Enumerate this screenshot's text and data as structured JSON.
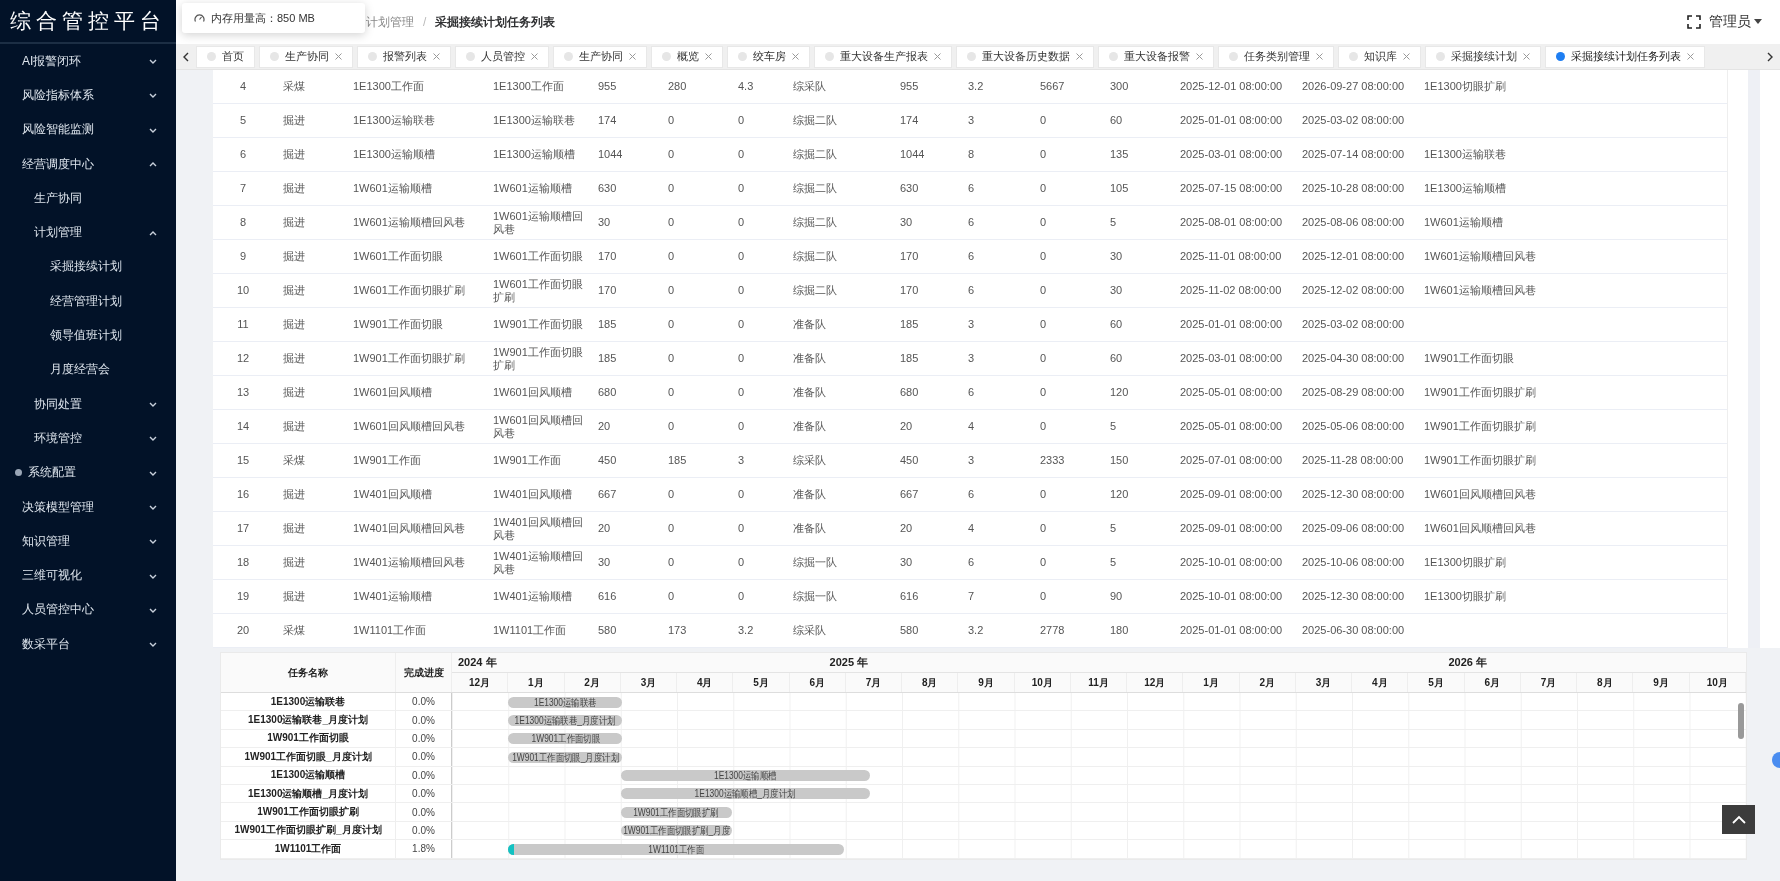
{
  "sidebar": {
    "title": "综合管控平台",
    "items": [
      {
        "kind": "group",
        "label": "AI报警闭环",
        "expanded": false
      },
      {
        "kind": "group",
        "label": "风险指标体系",
        "expanded": false
      },
      {
        "kind": "group",
        "label": "风险智能监测",
        "expanded": false
      },
      {
        "kind": "group",
        "label": "经营调度中心",
        "expanded": true,
        "children": [
          {
            "kind": "link",
            "label": "生产协同"
          },
          {
            "kind": "group",
            "label": "计划管理",
            "expanded": true,
            "children": [
              {
                "kind": "link",
                "label": "采掘接续计划"
              },
              {
                "kind": "link",
                "label": "经营管理计划"
              },
              {
                "kind": "link",
                "label": "领导值班计划"
              },
              {
                "kind": "link",
                "label": "月度经营会"
              }
            ]
          },
          {
            "kind": "group",
            "label": "协同处置",
            "expanded": false
          },
          {
            "kind": "group",
            "label": "环境管控",
            "expanded": false
          }
        ]
      },
      {
        "kind": "dotted-group",
        "label": "系统配置",
        "expanded": false
      },
      {
        "kind": "group",
        "label": "决策模型管理",
        "expanded": false
      },
      {
        "kind": "group",
        "label": "知识管理",
        "expanded": false
      },
      {
        "kind": "group",
        "label": "三维可视化",
        "expanded": false
      },
      {
        "kind": "group",
        "label": "人员管控中心",
        "expanded": false
      },
      {
        "kind": "group",
        "label": "数采平台",
        "expanded": false
      }
    ]
  },
  "memory_tooltip": {
    "text": "内存用量高：850 MB"
  },
  "breadcrumb": {
    "separator": "/",
    "items": [
      "计划管理",
      "采掘接续计划任务列表"
    ]
  },
  "user": {
    "name": "管理员"
  },
  "tabs": [
    {
      "label": "首页",
      "selected": false,
      "closable": false
    },
    {
      "label": "生产协同",
      "selected": false,
      "closable": true
    },
    {
      "label": "报警列表",
      "selected": false,
      "closable": true
    },
    {
      "label": "人员管控",
      "selected": false,
      "closable": true
    },
    {
      "label": "生产协同",
      "selected": false,
      "closable": true
    },
    {
      "label": "概览",
      "selected": false,
      "closable": true
    },
    {
      "label": "绞车房",
      "selected": false,
      "closable": true
    },
    {
      "label": "重大设备生产报表",
      "selected": false,
      "closable": true
    },
    {
      "label": "重大设备历史数据",
      "selected": false,
      "closable": true
    },
    {
      "label": "重大设备报警",
      "selected": false,
      "closable": true
    },
    {
      "label": "任务类别管理",
      "selected": false,
      "closable": true
    },
    {
      "label": "知识库",
      "selected": false,
      "closable": true
    },
    {
      "label": "采掘接续计划",
      "selected": false,
      "closable": true
    },
    {
      "label": "采掘接续计划任务列表",
      "selected": true,
      "closable": true
    }
  ],
  "table": {
    "rows": [
      [
        "4",
        "采煤",
        "1E1300工作面",
        "1E1300工作面",
        "955",
        "280",
        "4.3",
        "综采队",
        "955",
        "3.2",
        "5667",
        "300",
        "2025-12-01 08:00:00",
        "2026-09-27 08:00:00",
        "1E1300切眼扩刷"
      ],
      [
        "5",
        "掘进",
        "1E1300运输联巷",
        "1E1300运输联巷",
        "174",
        "0",
        "0",
        "综掘二队",
        "174",
        "3",
        "0",
        "60",
        "2025-01-01 08:00:00",
        "2025-03-02 08:00:00",
        ""
      ],
      [
        "6",
        "掘进",
        "1E1300运输顺槽",
        "1E1300运输顺槽",
        "1044",
        "0",
        "0",
        "综掘二队",
        "1044",
        "8",
        "0",
        "135",
        "2025-03-01 08:00:00",
        "2025-07-14 08:00:00",
        "1E1300运输联巷"
      ],
      [
        "7",
        "掘进",
        "1W601运输顺槽",
        "1W601运输顺槽",
        "630",
        "0",
        "0",
        "综掘二队",
        "630",
        "6",
        "0",
        "105",
        "2025-07-15 08:00:00",
        "2025-10-28 08:00:00",
        "1E1300运输顺槽"
      ],
      [
        "8",
        "掘进",
        "1W601运输顺槽回风巷",
        "1W601运输顺槽回风巷",
        "30",
        "0",
        "0",
        "综掘二队",
        "30",
        "6",
        "0",
        "5",
        "2025-08-01 08:00:00",
        "2025-08-06 08:00:00",
        "1W601运输顺槽"
      ],
      [
        "9",
        "掘进",
        "1W601工作面切眼",
        "1W601工作面切眼",
        "170",
        "0",
        "0",
        "综掘二队",
        "170",
        "6",
        "0",
        "30",
        "2025-11-01 08:00:00",
        "2025-12-01 08:00:00",
        "1W601运输顺槽回风巷"
      ],
      [
        "10",
        "掘进",
        "1W601工作面切眼扩刷",
        "1W601工作面切眼扩刷",
        "170",
        "0",
        "0",
        "综掘二队",
        "170",
        "6",
        "0",
        "30",
        "2025-11-02 08:00:00",
        "2025-12-02 08:00:00",
        "1W601运输顺槽回风巷"
      ],
      [
        "11",
        "掘进",
        "1W901工作面切眼",
        "1W901工作面切眼",
        "185",
        "0",
        "0",
        "准备队",
        "185",
        "3",
        "0",
        "60",
        "2025-01-01 08:00:00",
        "2025-03-02 08:00:00",
        ""
      ],
      [
        "12",
        "掘进",
        "1W901工作面切眼扩刷",
        "1W901工作面切眼扩刷",
        "185",
        "0",
        "0",
        "准备队",
        "185",
        "3",
        "0",
        "60",
        "2025-03-01 08:00:00",
        "2025-04-30 08:00:00",
        "1W901工作面切眼"
      ],
      [
        "13",
        "掘进",
        "1W601回风顺槽",
        "1W601回风顺槽",
        "680",
        "0",
        "0",
        "准备队",
        "680",
        "6",
        "0",
        "120",
        "2025-05-01 08:00:00",
        "2025-08-29 08:00:00",
        "1W901工作面切眼扩刷"
      ],
      [
        "14",
        "掘进",
        "1W601回风顺槽回风巷",
        "1W601回风顺槽回风巷",
        "20",
        "0",
        "0",
        "准备队",
        "20",
        "4",
        "0",
        "5",
        "2025-05-01 08:00:00",
        "2025-05-06 08:00:00",
        "1W901工作面切眼扩刷"
      ],
      [
        "15",
        "采煤",
        "1W901工作面",
        "1W901工作面",
        "450",
        "185",
        "3",
        "综采队",
        "450",
        "3",
        "2333",
        "150",
        "2025-07-01 08:00:00",
        "2025-11-28 08:00:00",
        "1W901工作面切眼扩刷"
      ],
      [
        "16",
        "掘进",
        "1W401回风顺槽",
        "1W401回风顺槽",
        "667",
        "0",
        "0",
        "准备队",
        "667",
        "6",
        "0",
        "120",
        "2025-09-01 08:00:00",
        "2025-12-30 08:00:00",
        "1W601回风顺槽回风巷"
      ],
      [
        "17",
        "掘进",
        "1W401回风顺槽回风巷",
        "1W401回风顺槽回风巷",
        "20",
        "0",
        "0",
        "准备队",
        "20",
        "4",
        "0",
        "5",
        "2025-09-01 08:00:00",
        "2025-09-06 08:00:00",
        "1W601回风顺槽回风巷"
      ],
      [
        "18",
        "掘进",
        "1W401运输顺槽回风巷",
        "1W401运输顺槽回风巷",
        "30",
        "0",
        "0",
        "综掘一队",
        "30",
        "6",
        "0",
        "5",
        "2025-10-01 08:00:00",
        "2025-10-06 08:00:00",
        "1E1300切眼扩刷"
      ],
      [
        "19",
        "掘进",
        "1W401运输顺槽",
        "1W401运输顺槽",
        "616",
        "0",
        "0",
        "综掘一队",
        "616",
        "7",
        "0",
        "90",
        "2025-10-01 08:00:00",
        "2025-12-30 08:00:00",
        "1E1300切眼扩刷"
      ],
      [
        "20",
        "采煤",
        "1W1101工作面",
        "1W1101工作面",
        "580",
        "173",
        "3.2",
        "综采队",
        "580",
        "3.2",
        "2778",
        "180",
        "2025-01-01 08:00:00",
        "2025-06-30 08:00:00",
        ""
      ]
    ]
  },
  "gantt": {
    "columns": [
      "任务名称",
      "完成进度"
    ],
    "years": [
      {
        "label": "2024 年",
        "months": [
          "12月"
        ]
      },
      {
        "label": "2025 年",
        "months": [
          "1月",
          "2月",
          "3月",
          "4月",
          "5月",
          "6月",
          "7月",
          "8月",
          "9月",
          "10月",
          "11月",
          "12月"
        ]
      },
      {
        "label": "2026 年",
        "months": [
          "1月",
          "2月",
          "3月",
          "4月",
          "5月",
          "6月",
          "7月",
          "8月",
          "9月",
          "10月"
        ]
      }
    ],
    "tasks": [
      {
        "name": "1E1300运输联巷",
        "progress": "0.0%",
        "bar_label": "1E1300运输联巷"
      },
      {
        "name": "1E1300运输联巷_月度计划",
        "progress": "0.0%",
        "bar_label": "1E1300运输联巷_月度计划"
      },
      {
        "name": "1W901工作面切眼",
        "progress": "0.0%",
        "bar_label": "1W901工作面切眼"
      },
      {
        "name": "1W901工作面切眼_月度计划",
        "progress": "0.0%",
        "bar_label": "1W901工作面切眼_月度计划"
      },
      {
        "name": "1E1300运输顺槽",
        "progress": "0.0%",
        "bar_label": "1E1300运输顺槽"
      },
      {
        "name": "1E1300运输顺槽_月度计划",
        "progress": "0.0%",
        "bar_label": "1E1300运输顺槽_月度计划"
      },
      {
        "name": "1W901工作面切眼扩刷",
        "progress": "0.0%",
        "bar_label": "1W901工作面切眼扩刷"
      },
      {
        "name": "1W901工作面切眼扩刷_月度计划",
        "progress": "0.0%",
        "bar_label": "1W901工作面切眼扩刷_月度"
      },
      {
        "name": "1W1101工作面",
        "progress": "1.8%",
        "level": 0.018,
        "bar_label": "1W1101工作面"
      }
    ]
  }
}
